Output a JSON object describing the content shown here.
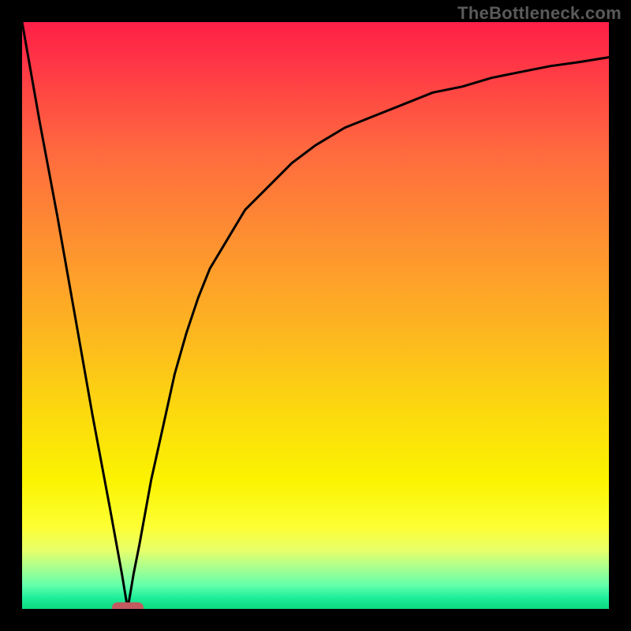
{
  "watermark": "TheBottleneck.com",
  "colors": {
    "frame": "#000000",
    "curve": "#000000",
    "marker": "#c25a5f"
  },
  "chart_data": {
    "type": "line",
    "title": "",
    "xlabel": "",
    "ylabel": "",
    "xlim": [
      0,
      100
    ],
    "ylim": [
      0,
      100
    ],
    "grid": false,
    "optimum_x": 18,
    "series": [
      {
        "name": "bottleneck-curve",
        "x": [
          0,
          3,
          6,
          9,
          12,
          15,
          17,
          18,
          19,
          20,
          22,
          24,
          26,
          28,
          30,
          32,
          35,
          38,
          42,
          46,
          50,
          55,
          60,
          65,
          70,
          75,
          80,
          85,
          90,
          95,
          100
        ],
        "values": [
          100,
          83,
          67,
          50,
          33,
          17,
          6,
          0,
          6,
          11,
          22,
          31,
          40,
          47,
          53,
          58,
          63,
          68,
          72,
          76,
          79,
          82,
          84,
          86,
          88,
          89,
          90.5,
          91.5,
          92.5,
          93.2,
          94
        ]
      }
    ],
    "marker": {
      "x": 18,
      "y": 0
    }
  }
}
